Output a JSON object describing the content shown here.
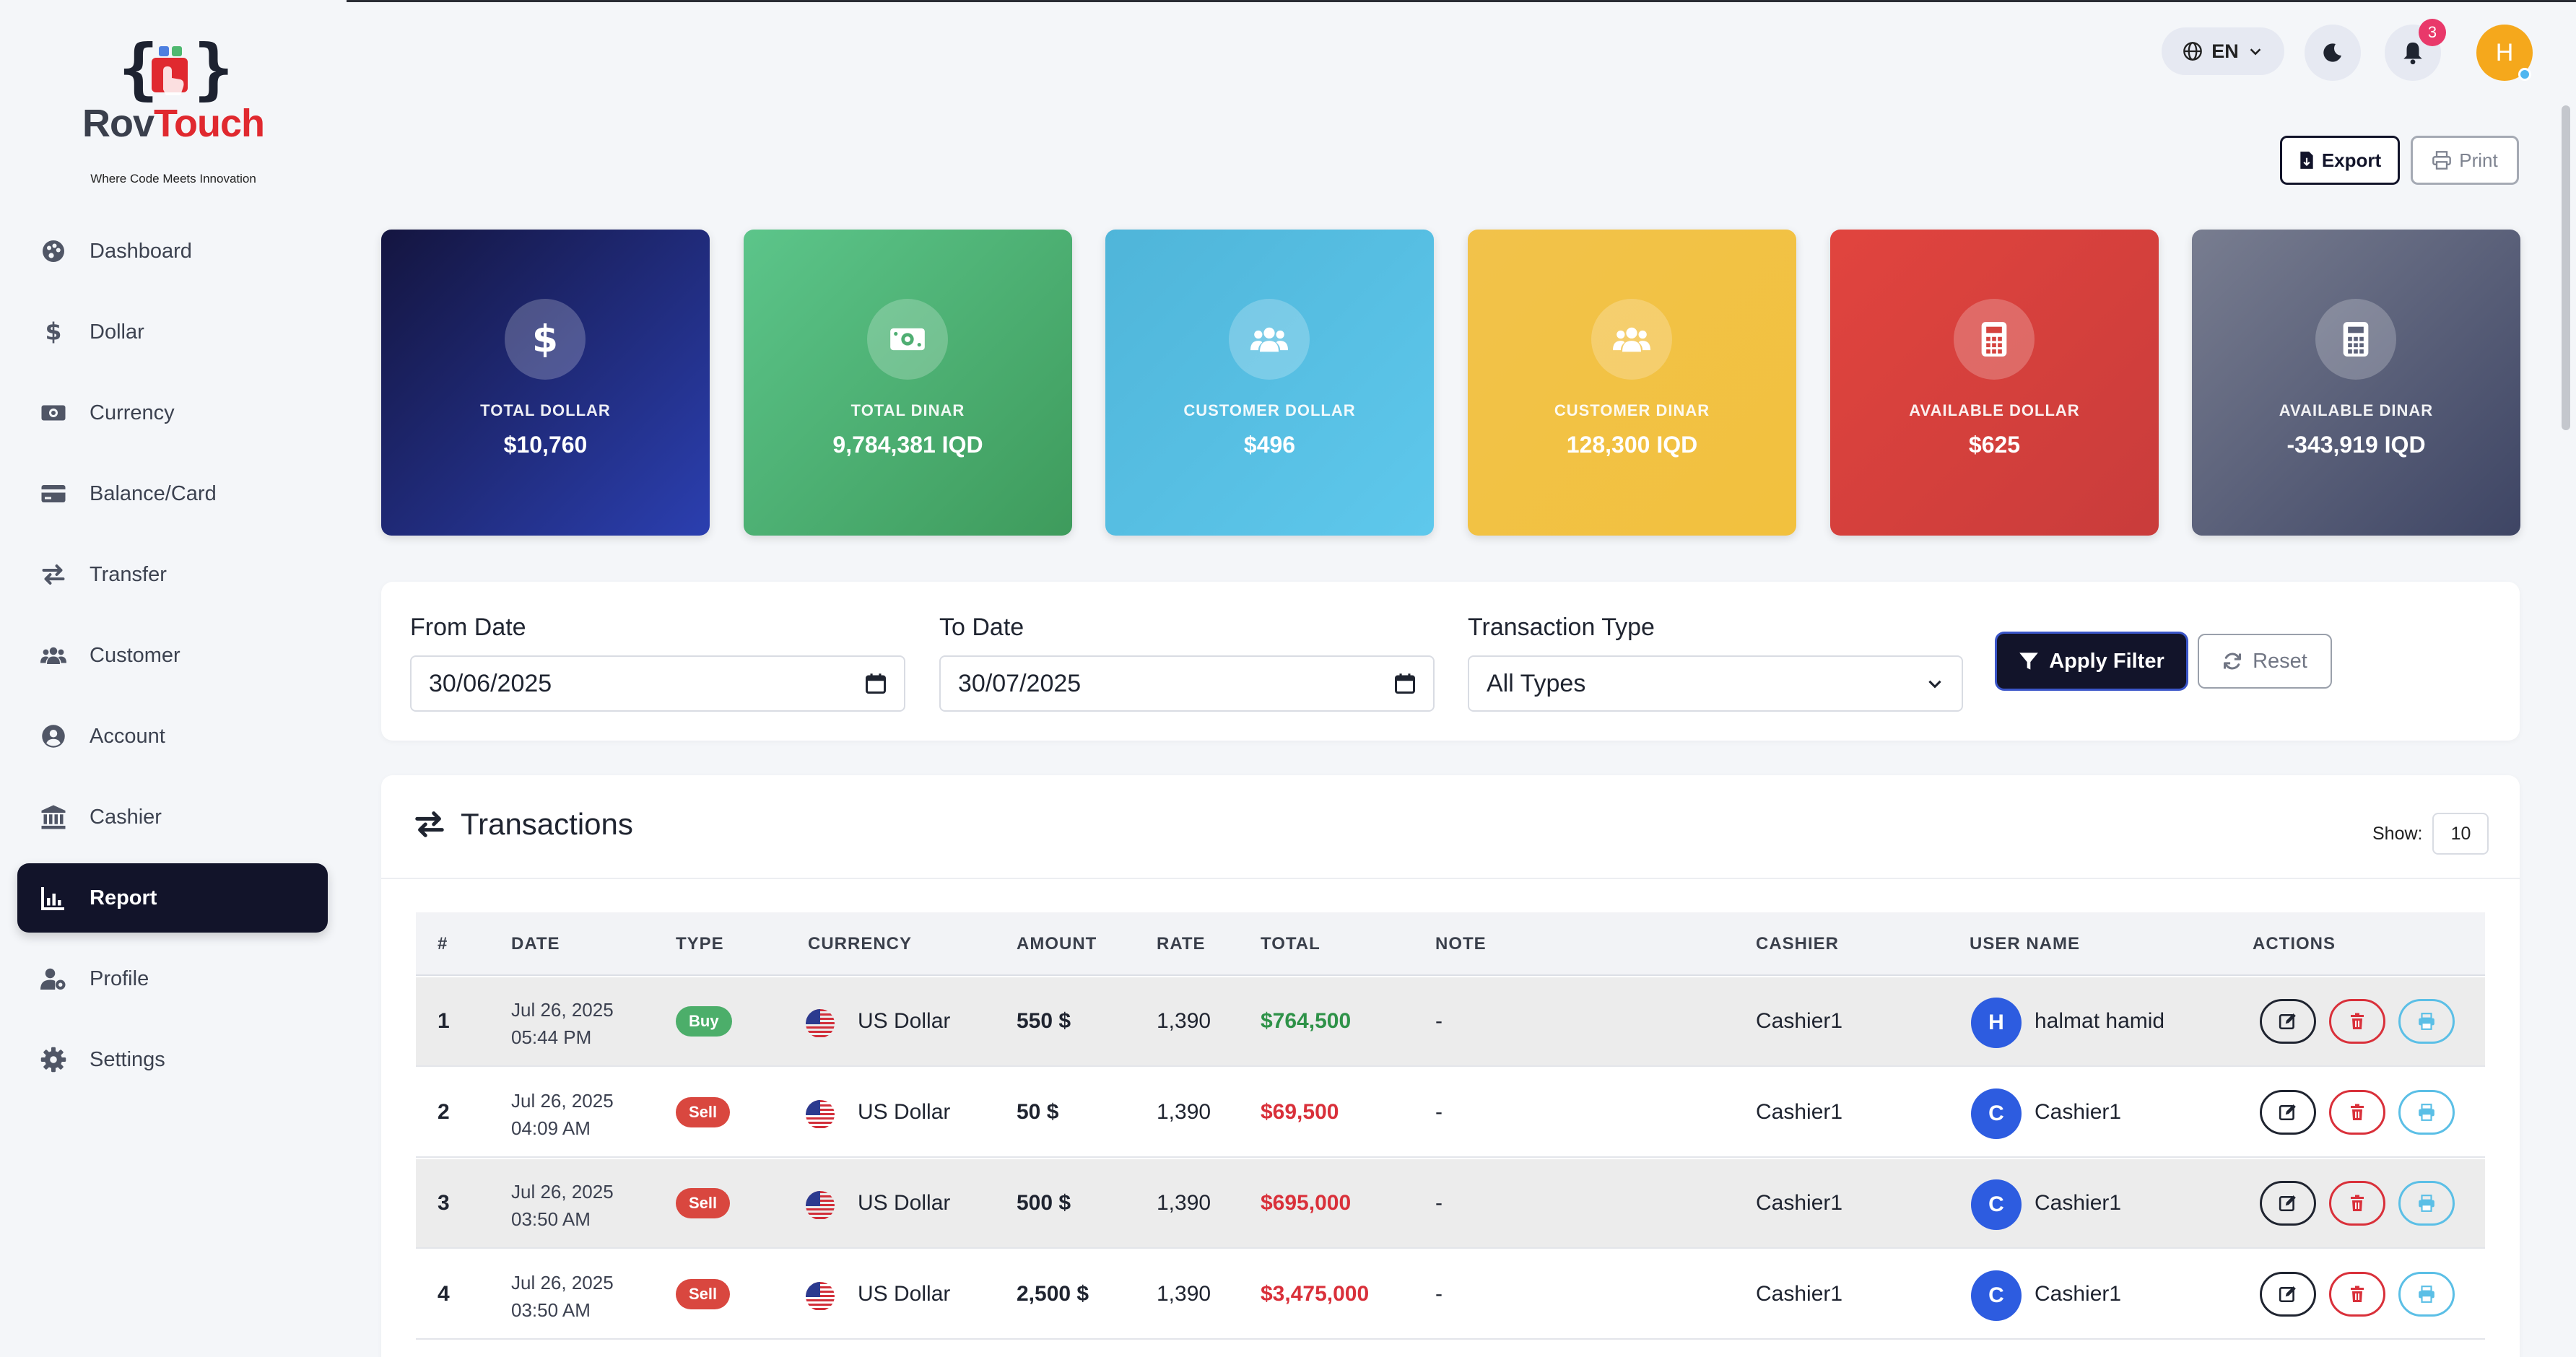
{
  "brand": {
    "name_part1": "Rov",
    "name_part2": "Touch",
    "tagline": "Where Code Meets Innovation"
  },
  "sidebar": {
    "items": [
      {
        "label": "Dashboard",
        "icon": "palette-icon"
      },
      {
        "label": "Dollar",
        "icon": "dollar-icon"
      },
      {
        "label": "Currency",
        "icon": "money-icon"
      },
      {
        "label": "Balance/Card",
        "icon": "card-icon"
      },
      {
        "label": "Transfer",
        "icon": "transfer-icon"
      },
      {
        "label": "Customer",
        "icon": "users-icon"
      },
      {
        "label": "Account",
        "icon": "user-circle-icon"
      },
      {
        "label": "Cashier",
        "icon": "bank-icon"
      },
      {
        "label": "Report",
        "icon": "chart-icon",
        "active": true
      },
      {
        "label": "Profile",
        "icon": "user-gear-icon"
      },
      {
        "label": "Settings",
        "icon": "gear-icon"
      }
    ]
  },
  "header": {
    "language": "EN",
    "notification_count": "3",
    "avatar_initial": "H",
    "export_label": "Export",
    "print_label": "Print"
  },
  "stats": [
    {
      "label": "TOTAL DOLLAR",
      "value": "$10,760",
      "icon": "dollar-icon",
      "color_from": "#141540",
      "color_to": "#2b3fb0"
    },
    {
      "label": "TOTAL DINAR",
      "value": "9,784,381 IQD",
      "icon": "money-icon",
      "color_from": "#5cc58a",
      "color_to": "#3e9b5c"
    },
    {
      "label": "CUSTOMER DOLLAR",
      "value": "$496",
      "icon": "users-icon",
      "color_from": "#4fb5d9",
      "color_to": "#5ec8ec"
    },
    {
      "label": "CUSTOMER DINAR",
      "value": "128,300 IQD",
      "icon": "users-icon",
      "color_from": "#f2c24a",
      "color_to": "#f2c13e"
    },
    {
      "label": "AVAILABLE DOLLAR",
      "value": "$625",
      "icon": "calculator-icon",
      "color_from": "#e1443e",
      "color_to": "#c93c3b"
    },
    {
      "label": "AVAILABLE DINAR",
      "value": "-343,919 IQD",
      "icon": "calculator-icon",
      "color_from": "#787d90",
      "color_to": "#3e4564"
    }
  ],
  "filter": {
    "from_label": "From Date",
    "from_value": "30/06/2025",
    "to_label": "To Date",
    "to_value": "30/07/2025",
    "type_label": "Transaction Type",
    "type_value": "All Types",
    "apply_label": "Apply Filter",
    "reset_label": "Reset"
  },
  "transactions": {
    "title": "Transactions",
    "show_label": "Show:",
    "show_value": "10",
    "columns": [
      "#",
      "DATE",
      "TYPE",
      "CURRENCY",
      "AMOUNT",
      "RATE",
      "TOTAL",
      "NOTE",
      "CASHIER",
      "USER NAME",
      "ACTIONS"
    ],
    "rows": [
      {
        "no": "1",
        "date": "Jul 26, 2025",
        "time": "05:44 PM",
        "type": "Buy",
        "currency": "US Dollar",
        "amount": "550 $",
        "rate": "1,390",
        "total": "$764,500",
        "note": "-",
        "cashier": "Cashier1",
        "user_initial": "H",
        "user": "halmat hamid"
      },
      {
        "no": "2",
        "date": "Jul 26, 2025",
        "time": "04:09 AM",
        "type": "Sell",
        "currency": "US Dollar",
        "amount": "50 $",
        "rate": "1,390",
        "total": "$69,500",
        "note": "-",
        "cashier": "Cashier1",
        "user_initial": "C",
        "user": "Cashier1"
      },
      {
        "no": "3",
        "date": "Jul 26, 2025",
        "time": "03:50 AM",
        "type": "Sell",
        "currency": "US Dollar",
        "amount": "500 $",
        "rate": "1,390",
        "total": "$695,000",
        "note": "-",
        "cashier": "Cashier1",
        "user_initial": "C",
        "user": "Cashier1"
      },
      {
        "no": "4",
        "date": "Jul 26, 2025",
        "time": "03:50 AM",
        "type": "Sell",
        "currency": "US Dollar",
        "amount": "2,500 $",
        "rate": "1,390",
        "total": "$3,475,000",
        "note": "-",
        "cashier": "Cashier1",
        "user_initial": "C",
        "user": "Cashier1"
      }
    ]
  }
}
